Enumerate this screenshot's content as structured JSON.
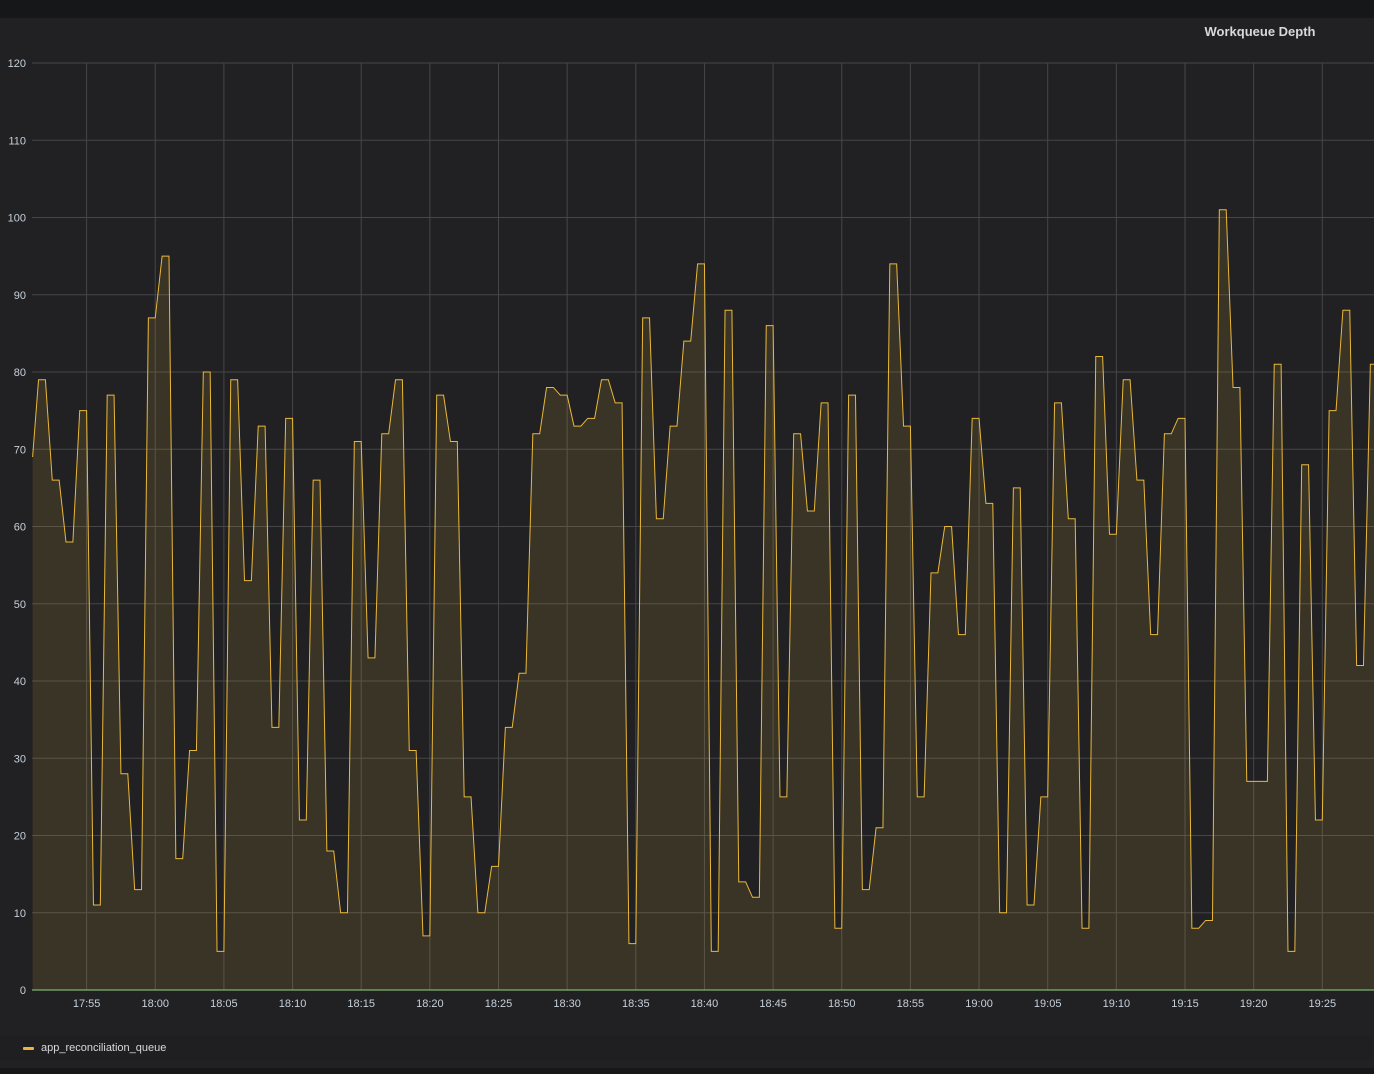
{
  "chart_data": {
    "type": "area",
    "title": "Workqueue Depth",
    "xlabel": "",
    "ylabel": "",
    "ylim": [
      0,
      120
    ],
    "yticks": [
      "0",
      "10",
      "20",
      "30",
      "40",
      "50",
      "60",
      "70",
      "80",
      "90",
      "100",
      "110",
      "120"
    ],
    "xtick_labels": [
      "17:55",
      "18:00",
      "18:05",
      "18:10",
      "18:15",
      "18:20",
      "18:25",
      "18:30",
      "18:35",
      "18:40",
      "18:45",
      "18:50",
      "18:55",
      "19:00",
      "19:05",
      "19:10",
      "19:15",
      "19:20",
      "19:25"
    ],
    "legend": "bottom-left",
    "grid": true,
    "line_color": "#eab839",
    "series": [
      {
        "name": "app_reconciliation_queue",
        "points": [
          [
            "17:51:04",
            69
          ],
          [
            "17:51:30",
            79
          ],
          [
            "17:52:00",
            79
          ],
          [
            "17:52:30",
            66
          ],
          [
            "17:53:00",
            66
          ],
          [
            "17:53:30",
            58
          ],
          [
            "17:54:00",
            58
          ],
          [
            "17:54:30",
            75
          ],
          [
            "17:55:00",
            75
          ],
          [
            "17:55:30",
            11
          ],
          [
            "17:56:00",
            11
          ],
          [
            "17:56:30",
            77
          ],
          [
            "17:57:00",
            77
          ],
          [
            "17:57:30",
            28
          ],
          [
            "17:58:00",
            28
          ],
          [
            "17:58:30",
            13
          ],
          [
            "17:59:00",
            13
          ],
          [
            "17:59:30",
            87
          ],
          [
            "18:00:00",
            87
          ],
          [
            "18:00:30",
            95
          ],
          [
            "18:01:00",
            95
          ],
          [
            "18:01:30",
            17
          ],
          [
            "18:02:00",
            17
          ],
          [
            "18:02:30",
            31
          ],
          [
            "18:03:00",
            31
          ],
          [
            "18:03:30",
            80
          ],
          [
            "18:04:00",
            80
          ],
          [
            "18:04:30",
            5
          ],
          [
            "18:05:00",
            5
          ],
          [
            "18:05:30",
            79
          ],
          [
            "18:06:00",
            79
          ],
          [
            "18:06:30",
            53
          ],
          [
            "18:07:00",
            53
          ],
          [
            "18:07:30",
            73
          ],
          [
            "18:08:00",
            73
          ],
          [
            "18:08:30",
            34
          ],
          [
            "18:09:00",
            34
          ],
          [
            "18:09:30",
            74
          ],
          [
            "18:10:00",
            74
          ],
          [
            "18:10:30",
            22
          ],
          [
            "18:11:00",
            22
          ],
          [
            "18:11:30",
            66
          ],
          [
            "18:12:00",
            66
          ],
          [
            "18:12:30",
            18
          ],
          [
            "18:13:00",
            18
          ],
          [
            "18:13:30",
            10
          ],
          [
            "18:14:00",
            10
          ],
          [
            "18:14:30",
            71
          ],
          [
            "18:15:00",
            71
          ],
          [
            "18:15:30",
            43
          ],
          [
            "18:16:00",
            43
          ],
          [
            "18:16:30",
            72
          ],
          [
            "18:17:00",
            72
          ],
          [
            "18:17:30",
            79
          ],
          [
            "18:18:00",
            79
          ],
          [
            "18:18:30",
            31
          ],
          [
            "18:19:00",
            31
          ],
          [
            "18:19:30",
            7
          ],
          [
            "18:20:00",
            7
          ],
          [
            "18:20:30",
            77
          ],
          [
            "18:21:00",
            77
          ],
          [
            "18:21:30",
            71
          ],
          [
            "18:22:00",
            71
          ],
          [
            "18:22:30",
            25
          ],
          [
            "18:23:00",
            25
          ],
          [
            "18:23:30",
            10
          ],
          [
            "18:24:00",
            10
          ],
          [
            "18:24:30",
            16
          ],
          [
            "18:25:00",
            16
          ],
          [
            "18:25:30",
            34
          ],
          [
            "18:26:00",
            34
          ],
          [
            "18:26:30",
            41
          ],
          [
            "18:27:00",
            41
          ],
          [
            "18:27:30",
            72
          ],
          [
            "18:28:00",
            72
          ],
          [
            "18:28:30",
            78
          ],
          [
            "18:29:00",
            78
          ],
          [
            "18:29:30",
            77
          ],
          [
            "18:30:00",
            77
          ],
          [
            "18:30:30",
            73
          ],
          [
            "18:31:00",
            73
          ],
          [
            "18:31:30",
            74
          ],
          [
            "18:32:00",
            74
          ],
          [
            "18:32:30",
            79
          ],
          [
            "18:33:00",
            79
          ],
          [
            "18:33:30",
            76
          ],
          [
            "18:34:00",
            76
          ],
          [
            "18:34:30",
            6
          ],
          [
            "18:35:00",
            6
          ],
          [
            "18:35:30",
            87
          ],
          [
            "18:36:00",
            87
          ],
          [
            "18:36:30",
            61
          ],
          [
            "18:37:00",
            61
          ],
          [
            "18:37:30",
            73
          ],
          [
            "18:38:00",
            73
          ],
          [
            "18:38:30",
            84
          ],
          [
            "18:39:00",
            84
          ],
          [
            "18:39:30",
            94
          ],
          [
            "18:40:00",
            94
          ],
          [
            "18:40:30",
            5
          ],
          [
            "18:41:00",
            5
          ],
          [
            "18:41:30",
            88
          ],
          [
            "18:42:00",
            88
          ],
          [
            "18:42:30",
            14
          ],
          [
            "18:43:00",
            14
          ],
          [
            "18:43:30",
            12
          ],
          [
            "18:44:00",
            12
          ],
          [
            "18:44:30",
            86
          ],
          [
            "18:45:00",
            86
          ],
          [
            "18:45:30",
            25
          ],
          [
            "18:46:00",
            25
          ],
          [
            "18:46:30",
            72
          ],
          [
            "18:47:00",
            72
          ],
          [
            "18:47:30",
            62
          ],
          [
            "18:48:00",
            62
          ],
          [
            "18:48:30",
            76
          ],
          [
            "18:49:00",
            76
          ],
          [
            "18:49:30",
            8
          ],
          [
            "18:50:00",
            8
          ],
          [
            "18:50:30",
            77
          ],
          [
            "18:51:00",
            77
          ],
          [
            "18:51:30",
            13
          ],
          [
            "18:52:00",
            13
          ],
          [
            "18:52:30",
            21
          ],
          [
            "18:53:00",
            21
          ],
          [
            "18:53:30",
            94
          ],
          [
            "18:54:00",
            94
          ],
          [
            "18:54:30",
            73
          ],
          [
            "18:55:00",
            73
          ],
          [
            "18:55:30",
            25
          ],
          [
            "18:56:00",
            25
          ],
          [
            "18:56:30",
            54
          ],
          [
            "18:57:00",
            54
          ],
          [
            "18:57:30",
            60
          ],
          [
            "18:58:00",
            60
          ],
          [
            "18:58:30",
            46
          ],
          [
            "18:59:00",
            46
          ],
          [
            "18:59:30",
            74
          ],
          [
            "19:00:00",
            74
          ],
          [
            "19:00:30",
            63
          ],
          [
            "19:01:00",
            63
          ],
          [
            "19:01:30",
            10
          ],
          [
            "19:02:00",
            10
          ],
          [
            "19:02:30",
            65
          ],
          [
            "19:03:00",
            65
          ],
          [
            "19:03:30",
            11
          ],
          [
            "19:04:00",
            11
          ],
          [
            "19:04:30",
            25
          ],
          [
            "19:05:00",
            25
          ],
          [
            "19:05:30",
            76
          ],
          [
            "19:06:00",
            76
          ],
          [
            "19:06:30",
            61
          ],
          [
            "19:07:00",
            61
          ],
          [
            "19:07:30",
            8
          ],
          [
            "19:08:00",
            8
          ],
          [
            "19:08:30",
            82
          ],
          [
            "19:09:00",
            82
          ],
          [
            "19:09:30",
            59
          ],
          [
            "19:10:00",
            59
          ],
          [
            "19:10:30",
            79
          ],
          [
            "19:11:00",
            79
          ],
          [
            "19:11:30",
            66
          ],
          [
            "19:12:00",
            66
          ],
          [
            "19:12:30",
            46
          ],
          [
            "19:13:00",
            46
          ],
          [
            "19:13:30",
            72
          ],
          [
            "19:14:00",
            72
          ],
          [
            "19:14:30",
            74
          ],
          [
            "19:15:00",
            74
          ],
          [
            "19:15:30",
            8
          ],
          [
            "19:16:00",
            8
          ],
          [
            "19:16:30",
            9
          ],
          [
            "19:17:00",
            9
          ],
          [
            "19:17:30",
            101
          ],
          [
            "19:18:00",
            101
          ],
          [
            "19:18:30",
            78
          ],
          [
            "19:19:00",
            78
          ],
          [
            "19:19:30",
            27
          ],
          [
            "19:20:00",
            27
          ],
          [
            "19:20:30",
            27
          ],
          [
            "19:21:00",
            27
          ],
          [
            "19:21:30",
            81
          ],
          [
            "19:22:00",
            81
          ],
          [
            "19:22:30",
            5
          ],
          [
            "19:23:00",
            5
          ],
          [
            "19:23:30",
            68
          ],
          [
            "19:24:00",
            68
          ],
          [
            "19:24:30",
            22
          ],
          [
            "19:25:00",
            22
          ],
          [
            "19:25:30",
            75
          ],
          [
            "19:26:00",
            75
          ],
          [
            "19:26:30",
            88
          ],
          [
            "19:27:00",
            88
          ],
          [
            "19:27:30",
            42
          ],
          [
            "19:28:00",
            42
          ],
          [
            "19:28:30",
            81
          ],
          [
            "19:29:00",
            81
          ]
        ]
      }
    ]
  }
}
